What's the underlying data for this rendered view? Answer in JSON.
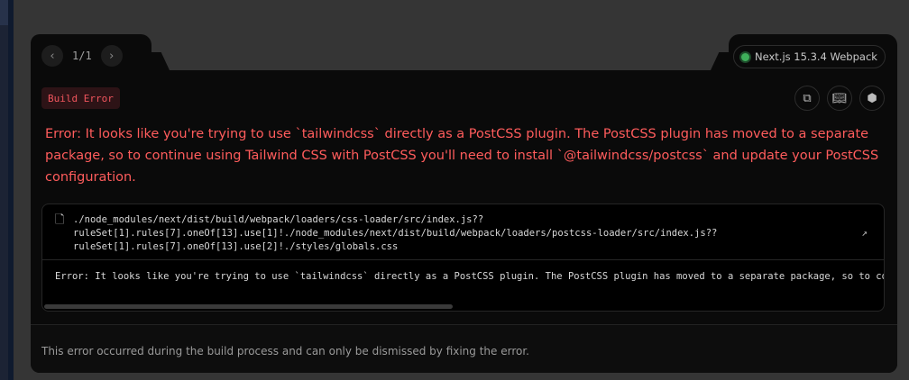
{
  "nav": {
    "counter": "1/1",
    "prev_icon": "chevron-left-icon",
    "next_icon": "chevron-right-icon"
  },
  "version": {
    "label": "Next.js 15.3.4 Webpack",
    "status_color": "#3fae5a"
  },
  "badge": "Build Error",
  "toolbar": {
    "icons": [
      "copy-icon",
      "docs-book-icon",
      "nextjs-hex-icon"
    ]
  },
  "message": "Error: It looks like you're trying to use `tailwindcss` directly as a PostCSS plugin. The PostCSS plugin has moved to a separate package, so to continue using Tailwind CSS with PostCSS you'll need to install `@tailwindcss/postcss` and update your PostCSS configuration.",
  "code": {
    "path_lines": [
      "./node_modules/next/dist/build/webpack/loaders/css-loader/src/index.js??",
      "ruleSet[1].rules[7].oneOf[13].use[1]!./node_modules/next/dist/build/webpack/loaders/postcss-loader/src/index.js??",
      "ruleSet[1].rules[7].oneOf[13].use[2]!./styles/globals.css"
    ],
    "body": "Error: It looks like you're trying to use `tailwindcss` directly as a PostCSS plugin. The PostCSS plugin has moved to a separate package, so to continue using Tailwind CSS with PostCSS you'll need to install `@tailwindcss/postcss` and update your PostCSS configuration."
  },
  "footer": "This error occurred during the build process and can only be dismissed by fixing the error.",
  "colors": {
    "error": "#ff5c5c",
    "background": "#0a0a0a"
  }
}
